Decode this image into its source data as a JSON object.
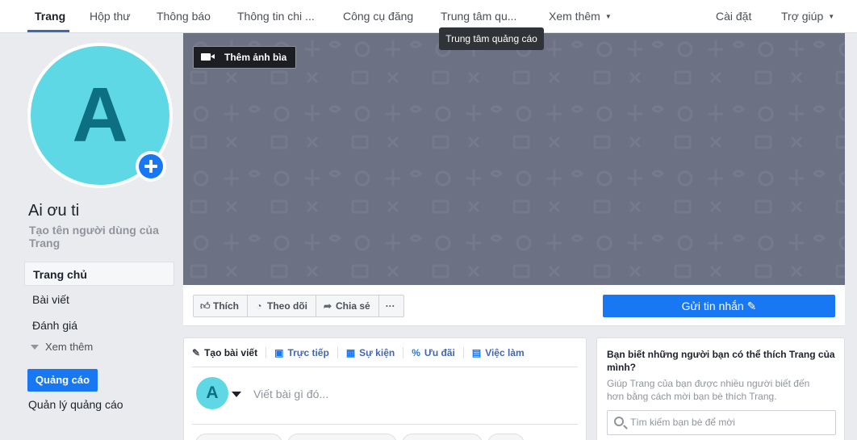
{
  "tabs": [
    {
      "label": "Trang",
      "active": true
    },
    {
      "label": "Hộp thư"
    },
    {
      "label": "Thông báo"
    },
    {
      "label": "Thông tin chi ..."
    },
    {
      "label": "Công cụ đăng"
    },
    {
      "label": "Trung tâm qu..."
    },
    {
      "label": "Xem thêm"
    },
    {
      "label": "Cài đặt"
    },
    {
      "label": "Trợ giúp"
    }
  ],
  "tooltip": "Trung tâm quảng cáo",
  "page": {
    "avatar_letter": "A",
    "name": "Ai ơu ti",
    "username_prompt": "Tạo tên người dùng của Trang"
  },
  "sidebar": {
    "items": [
      {
        "label": "Trang chủ",
        "active": true
      },
      {
        "label": "Bài viết"
      },
      {
        "label": "Đánh giá"
      }
    ],
    "see_more": "Xem thêm",
    "ads_button": "Quảng cáo",
    "ads_manage": "Quản lý quảng cáo"
  },
  "cover": {
    "add_cover_label": "Thêm ảnh bìa",
    "color": "#6c7284"
  },
  "actions": {
    "like": "Thích",
    "follow": "Theo dõi",
    "share": "Chia sẻ",
    "more": "···",
    "send_message": "Gửi tin nhắn"
  },
  "composer": {
    "tabs": [
      "Tạo bài viết",
      "Trực tiếp",
      "Sự kiện",
      "Ưu đãi",
      "Việc làm"
    ],
    "avatar_letter": "A",
    "placeholder": "Viết bài gì đó..."
  },
  "invite_card": {
    "title": "Bạn biết những người bạn có thể thích Trang của mình?",
    "description": "Giúp Trang của bạn được nhiều người biết đến hơn bằng cách mời bạn bè thích Trang.",
    "search_placeholder": "Tìm kiếm bạn bè để mời"
  },
  "colors": {
    "accent": "#1877f2",
    "nav_underline": "#4267b2",
    "avatar_bg": "#5fd8e6",
    "page_bg": "#e9ebee"
  }
}
